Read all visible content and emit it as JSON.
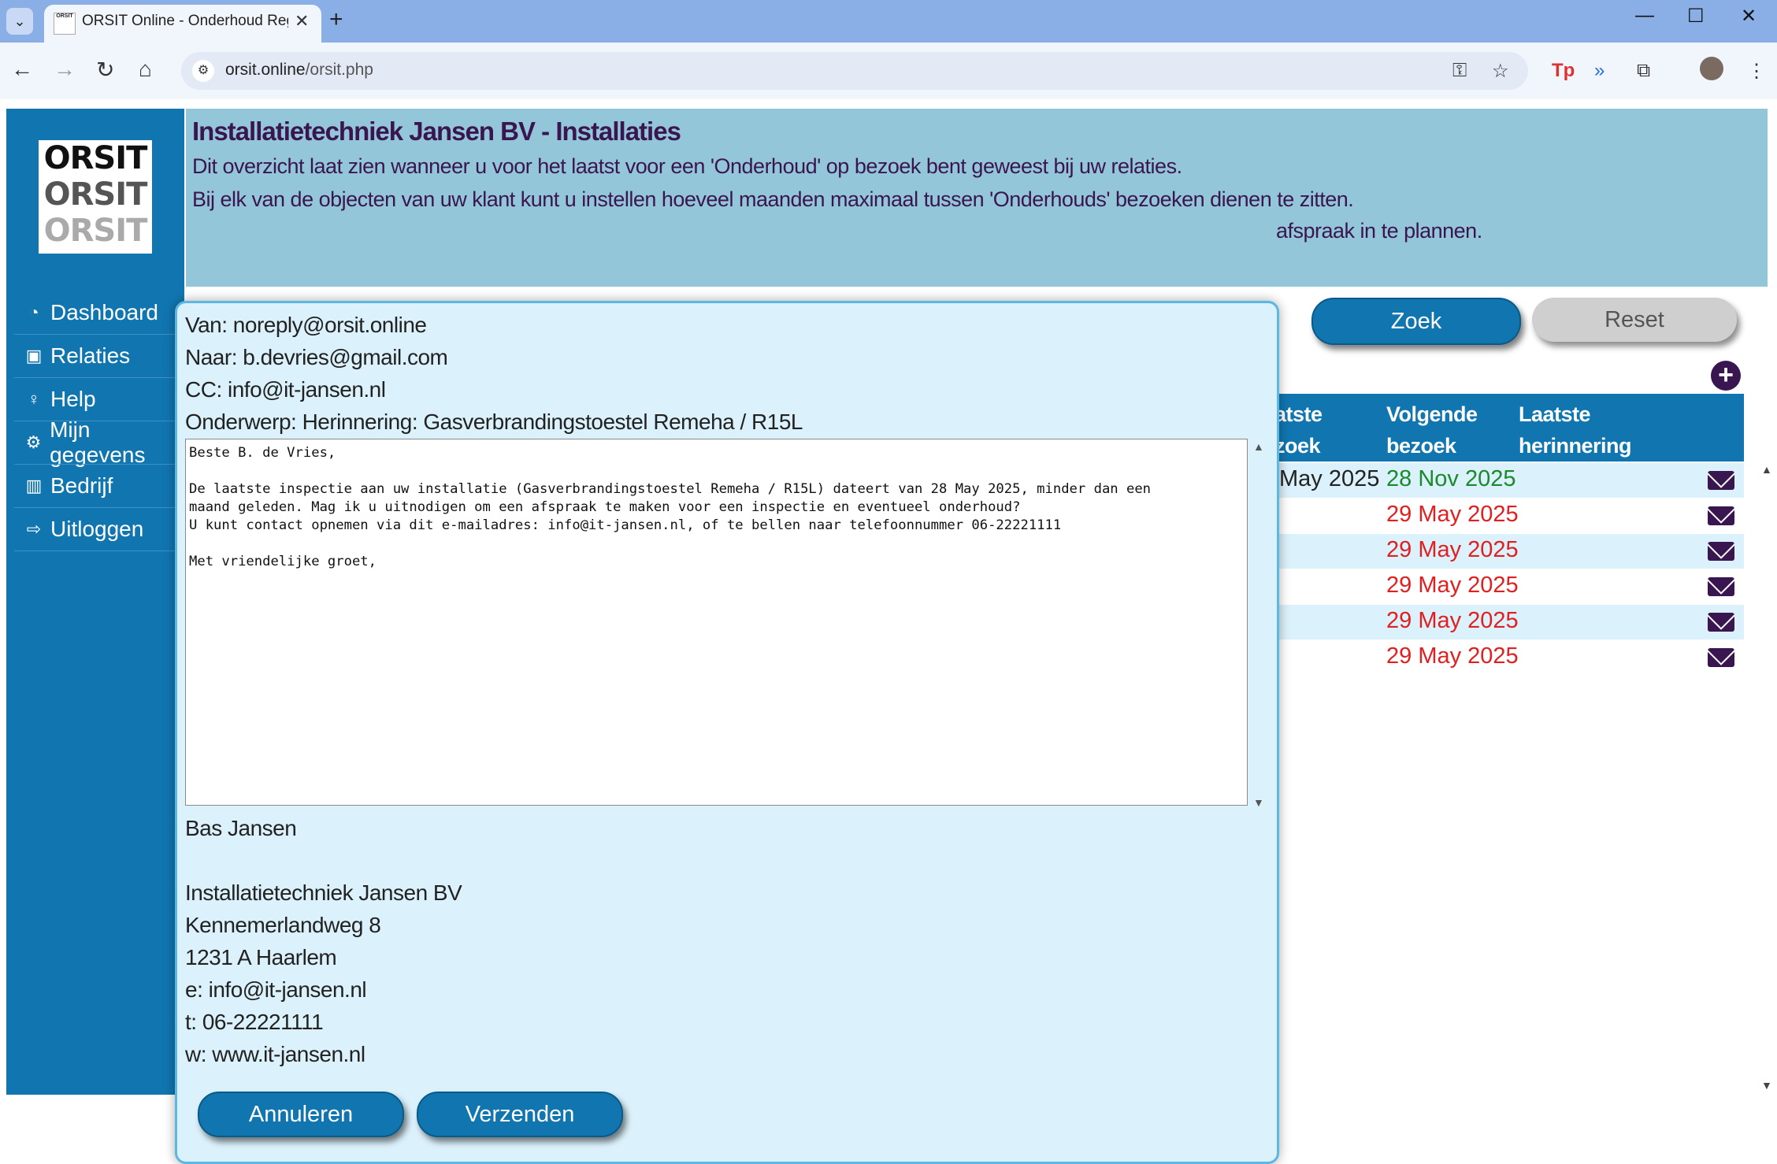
{
  "browser": {
    "tab_title": "ORSIT Online - Onderhoud Reg",
    "url_host": "orsit.online",
    "url_path": "/orsit.php",
    "favicon_text": "ORSIT"
  },
  "sidebar": {
    "logo": [
      "ORSIT",
      "ORSIT",
      "ORSIT"
    ],
    "items": [
      {
        "label": "Dashboard",
        "icon": "dashboard-icon"
      },
      {
        "label": "Relaties",
        "icon": "contacts-icon"
      },
      {
        "label": "Help",
        "icon": "lightbulb-icon"
      },
      {
        "label": "Mijn gegevens",
        "icon": "gears-icon"
      },
      {
        "label": "Bedrijf",
        "icon": "building-icon"
      },
      {
        "label": "Uitloggen",
        "icon": "logout-icon"
      }
    ]
  },
  "header": {
    "title": "Installatietechniek Jansen BV - Installaties",
    "line1": "Dit overzicht laat zien wanneer u voor het laatst voor een 'Onderhoud' op bezoek bent geweest bij uw relaties.",
    "line2": "Bij elk van de objecten van uw klant kunt u instellen hoeveel maanden maximaal tussen 'Onderhouds' bezoeken dienen te zitten.",
    "line3_tail": "afspraak in te plannen."
  },
  "search": {
    "zoek_label": "Zoek",
    "reset_label": "Reset"
  },
  "table": {
    "headers": {
      "last_visit_partial": "atste\nzoek",
      "next_visit": "Volgende\nbezoek",
      "last_reminder": "Laatste\nherinnering"
    },
    "rows": [
      {
        "last": "May 2025",
        "next": "28 Nov 2025",
        "next_color": "#1a8a2a"
      },
      {
        "last": "",
        "next": "29 May 2025",
        "next_color": "#e02020"
      },
      {
        "last": "",
        "next": "29 May 2025",
        "next_color": "#e02020"
      },
      {
        "last": "",
        "next": "29 May 2025",
        "next_color": "#e02020"
      },
      {
        "last": "",
        "next": "29 May 2025",
        "next_color": "#e02020"
      },
      {
        "last": "",
        "next": "29 May 2025",
        "next_color": "#e02020"
      }
    ]
  },
  "modal": {
    "van": "Van: noreply@orsit.online",
    "naar": "Naar: b.devries@gmail.com",
    "cc": "CC: info@it-jansen.nl",
    "onderwerp": "Onderwerp: Herinnering: Gasverbrandingstoestel Remeha / R15L",
    "body": "Beste B. de Vries,\n\nDe laatste inspectie aan uw installatie (Gasverbrandingstoestel Remeha / R15L) dateert van 28 May 2025, minder dan een\nmaand geleden. Mag ik u uitnodigen om een afspraak te maken voor een inspectie en eventueel onderhoud?\nU kunt contact opnemen via dit e-mailadres: info@it-jansen.nl, of te bellen naar telefoonnummer 06-22221111\n\nMet vriendelijke groet,",
    "signature": {
      "name": "Bas Jansen",
      "company": "Installatietechniek Jansen BV",
      "street": "Kennemerlandweg 8",
      "city": "1231 A Haarlem",
      "email": "e: info@it-jansen.nl",
      "phone": "t: 06-22221111",
      "web": "w: www.it-jansen.nl"
    },
    "cancel_label": "Annuleren",
    "send_label": "Verzenden"
  }
}
